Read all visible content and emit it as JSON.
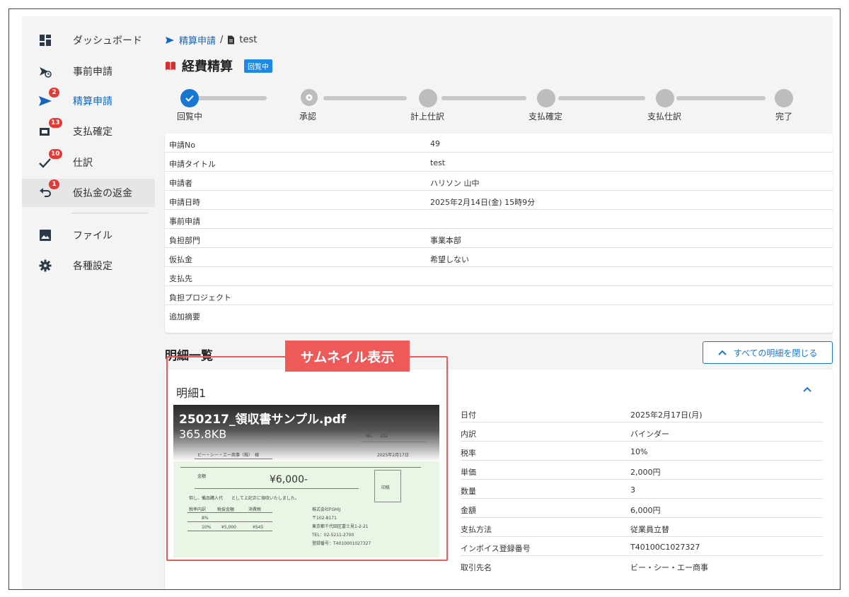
{
  "sidebar": {
    "items": [
      {
        "label": "ダッシュボード",
        "icon": "dashboard-icon"
      },
      {
        "label": "事前申請",
        "icon": "advance-request-icon"
      },
      {
        "label": "精算申請",
        "icon": "send-icon",
        "badge": "2"
      },
      {
        "label": "支払確定",
        "icon": "payment-confirm-icon",
        "badge": "13"
      },
      {
        "label": "仕訳",
        "icon": "check-icon",
        "badge": "10"
      },
      {
        "label": "仮払金の返金",
        "icon": "undo-icon",
        "badge": "1"
      },
      {
        "label": "ファイル",
        "icon": "image-file-icon"
      },
      {
        "label": "各種設定",
        "icon": "gear-icon"
      }
    ]
  },
  "breadcrumb": {
    "parent": "精算申請",
    "separator": "/",
    "current": "test"
  },
  "header": {
    "title": "経費精算",
    "status": "回覧中"
  },
  "stepper": {
    "steps": [
      {
        "label": "回覧中",
        "state": "done"
      },
      {
        "label": "承認",
        "state": "current"
      },
      {
        "label": "計上仕訳",
        "state": "pending"
      },
      {
        "label": "支払確定",
        "state": "pending"
      },
      {
        "label": "支払仕訳",
        "state": "pending"
      },
      {
        "label": "完了",
        "state": "pending"
      }
    ]
  },
  "info": {
    "rows": [
      {
        "key": "申請No",
        "value": "49"
      },
      {
        "key": "申請タイトル",
        "value": "test"
      },
      {
        "key": "申請者",
        "value": "ハリソン 山中"
      },
      {
        "key": "申請日時",
        "value": "2025年2月14日(金) 15時9分"
      },
      {
        "key": "事前申請",
        "value": ""
      },
      {
        "key": "負担部門",
        "value": "事業本部"
      },
      {
        "key": "仮払金",
        "value": "希望しない"
      },
      {
        "key": "支払先",
        "value": ""
      },
      {
        "key": "負担プロジェクト",
        "value": ""
      },
      {
        "key": "追加摘要",
        "value": ""
      }
    ]
  },
  "details": {
    "section_title": "明細一覧",
    "close_all_label": "すべての明細を閉じる",
    "callout": "サムネイル表示",
    "item": {
      "title": "明細1",
      "file_name": "250217_領収書サンプル.pdf",
      "file_size": "365.8KB",
      "receipt": {
        "no_label": "No.",
        "no_value": "202",
        "date": "2025年2月17日",
        "recipient": "ビー・シー・エー商事（株）　様",
        "amount_label": "金額",
        "amount": "¥6,000-",
        "stamp_label": "印紙",
        "note": "但し、備品購入代　　として上記正に領収いたしました。",
        "tax_headers": [
          "税率内訳",
          "税抜金額",
          "消費税"
        ],
        "tax_rows": [
          [
            "8%",
            "",
            ""
          ],
          [
            "10%",
            "¥5,000",
            "¥545"
          ]
        ],
        "company": "株式会社FGHIJ",
        "postal": "〒102-8171",
        "address": "東京都千代田区富士見1-2-21",
        "tel": "TEL：02-5211-2700",
        "reg_no": "登録番号：T4010001027327"
      },
      "fields": [
        {
          "key": "日付",
          "value": "2025年2月17日(月)"
        },
        {
          "key": "内訳",
          "value": "バインダー"
        },
        {
          "key": "税率",
          "value": "10%"
        },
        {
          "key": "単価",
          "value": "2,000円"
        },
        {
          "key": "数量",
          "value": "3"
        },
        {
          "key": "金額",
          "value": "6,000円"
        },
        {
          "key": "支払方法",
          "value": "従業員立替"
        },
        {
          "key": "インボイス登録番号",
          "value": "T40100C1027327"
        },
        {
          "key": "取引先名",
          "value": "ビー・シー・エー商事"
        }
      ]
    }
  },
  "colors": {
    "accent": "#1976d2",
    "badge": "#e53935",
    "highlight": "#ee5a5a"
  }
}
